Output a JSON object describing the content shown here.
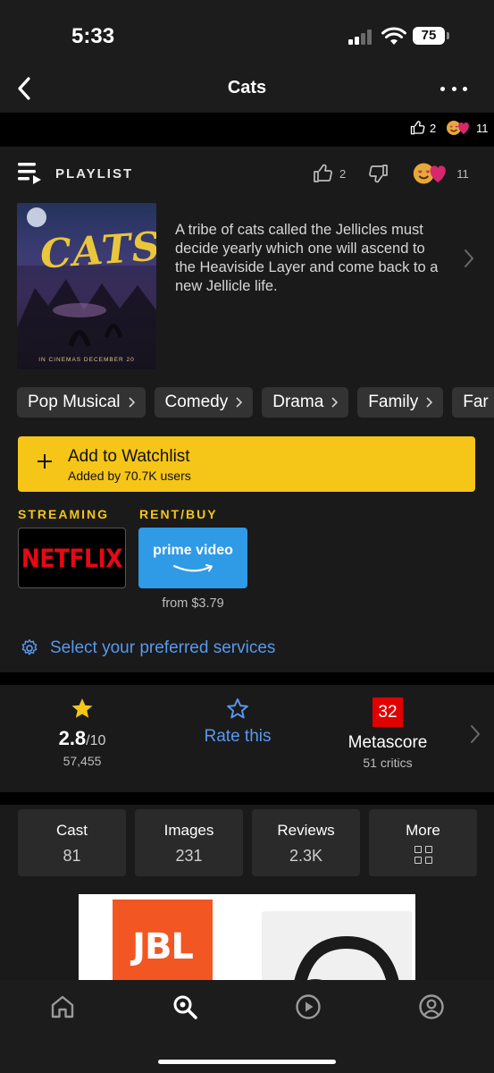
{
  "status": {
    "time": "5:33",
    "battery": "75"
  },
  "nav": {
    "title": "Cats"
  },
  "reactions_strip": {
    "likes": "2",
    "loves": "11"
  },
  "playlist": {
    "label": "PLAYLIST",
    "likes": "2",
    "loves": "11"
  },
  "poster": {
    "title": "CATS",
    "footer": "IN CINEMAS DECEMBER 20"
  },
  "synopsis": "A tribe of cats called the Jellicles must decide yearly which one will ascend to the Heaviside Layer and come back to a new Jellicle life.",
  "genres": [
    "Pop Musical",
    "Comedy",
    "Drama",
    "Family",
    "Far"
  ],
  "watchlist": {
    "title": "Add to Watchlist",
    "subtitle": "Added by 70.7K users"
  },
  "streaming": {
    "label": "STREAMING",
    "provider": "NETFLIX"
  },
  "rent_buy": {
    "label": "RENT/BUY",
    "provider": "prime video",
    "price": "from $3.79"
  },
  "services_link": "Select your preferred services",
  "ratings": {
    "imdb_score": "2.8",
    "imdb_scale": "/10",
    "imdb_votes": "57,455",
    "rate_label": "Rate this",
    "metascore": "32",
    "metascore_label": "Metascore",
    "critics": "51 critics"
  },
  "stats": [
    {
      "label": "Cast",
      "value": "81"
    },
    {
      "label": "Images",
      "value": "231"
    },
    {
      "label": "Reviews",
      "value": "2.3K"
    },
    {
      "label": "More"
    }
  ],
  "ad": {
    "brand": "JBL"
  },
  "tabs": [
    "home-icon",
    "search-icon",
    "video-icon",
    "profile-icon"
  ],
  "colors": {
    "accent": "#f5c518",
    "link": "#5799ef",
    "metascore_bg": "#e00000",
    "netflix_red": "#e50914",
    "prime_blue": "#2f9ae6",
    "jbl_orange": "#f25623"
  }
}
